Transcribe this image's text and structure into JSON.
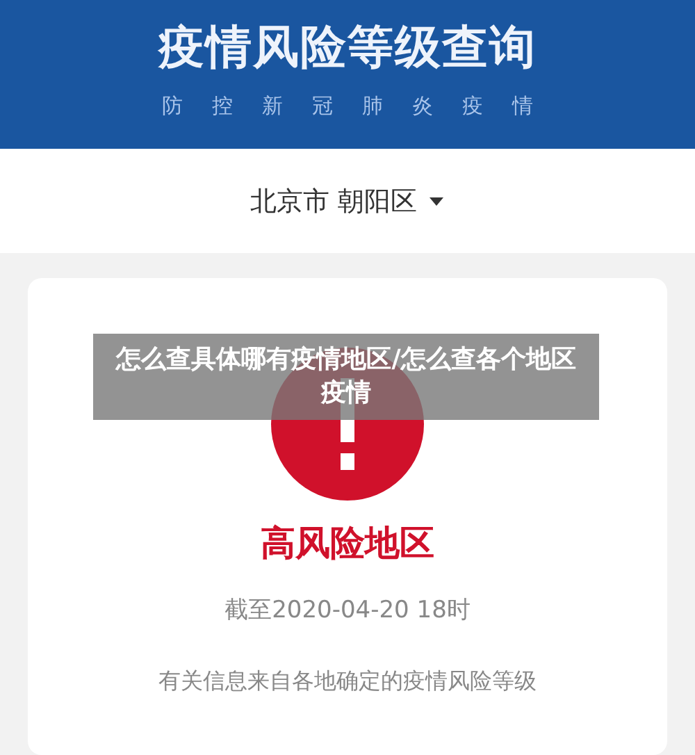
{
  "header": {
    "title": "疫情风险等级查询",
    "subtitle": [
      "防",
      "控",
      "新",
      "冠",
      "肺",
      "炎",
      "疫",
      "情"
    ]
  },
  "location": {
    "label": "北京市 朝阳区",
    "expanded": false
  },
  "result": {
    "kind": "high",
    "title": "高风险地区",
    "updated": "截至2020-04-20 18时",
    "note": "有关信息来自各地确定的疫情风险等级"
  },
  "overlay_caption": "怎么查具体哪有疫情地区/怎么查各个地区疫情"
}
